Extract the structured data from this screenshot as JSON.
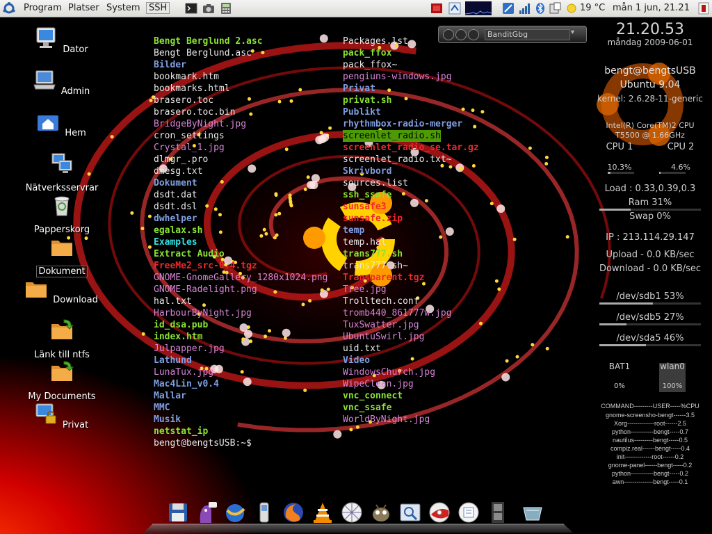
{
  "top_panel": {
    "menus": [
      "Program",
      "Platser",
      "System"
    ],
    "ssh_label": "SSH",
    "temperature": "19 °C",
    "clock": "mån  1 jun, 21.21",
    "icons": [
      "ubuntu-logo-icon",
      "terminal-icon",
      "camera-icon",
      "calculator-icon",
      "notes-icon",
      "update-icon",
      "network-monitor-icon",
      "rss-icon",
      "signal-icon",
      "bluetooth-icon",
      "power-icon",
      "weather-sun-icon",
      "logout-icon"
    ]
  },
  "desktop_icons": [
    {
      "label": "Dator",
      "icon": "computer-icon"
    },
    {
      "label": "Admin",
      "icon": "laptop-icon"
    },
    {
      "label": "Hem",
      "icon": "home-folder-icon"
    },
    {
      "label": "Nätverksservrar",
      "icon": "network-servers-icon"
    },
    {
      "label": "Papperskorg",
      "icon": "trash-icon"
    },
    {
      "label": "Dokument",
      "icon": "folder-icon",
      "selected": true
    },
    {
      "label": "Download",
      "icon": "folder-icon"
    },
    {
      "label": "Länk till ntfs",
      "icon": "folder-link-icon"
    },
    {
      "label": "My Documents",
      "icon": "folder-link-icon"
    },
    {
      "label": "Privat",
      "icon": "locked-computer-icon"
    }
  ],
  "ls_listing": {
    "column1": [
      {
        "name": "Bengt Berglund 2.asc",
        "type": "exe"
      },
      {
        "name": "Bengt Berglund.asc",
        "type": "file"
      },
      {
        "name": "Bilder",
        "type": "dir"
      },
      {
        "name": "bookmark.htm",
        "type": "file"
      },
      {
        "name": "bookmarks.html",
        "type": "file"
      },
      {
        "name": "brasero.toc",
        "type": "file"
      },
      {
        "name": "brasero.toc.bin",
        "type": "file"
      },
      {
        "name": "BridgeByNight.jpg",
        "type": "img"
      },
      {
        "name": "cron_settings",
        "type": "file"
      },
      {
        "name": "Crystal_1.jpg",
        "type": "img"
      },
      {
        "name": "dlmgr_.pro",
        "type": "file"
      },
      {
        "name": "dmesg.txt",
        "type": "file"
      },
      {
        "name": "Dokument",
        "type": "dir"
      },
      {
        "name": "dsdt.dat",
        "type": "file"
      },
      {
        "name": "dsdt.dsl",
        "type": "file"
      },
      {
        "name": "dwhelper",
        "type": "dir"
      },
      {
        "name": "egalax.sh",
        "type": "exe"
      },
      {
        "name": "Examples",
        "type": "link"
      },
      {
        "name": "Extract Audio",
        "type": "exe"
      },
      {
        "name": "FreeMe2_src-0.4.tgz",
        "type": "arc"
      },
      {
        "name": "GNOME-GnomeGallery_1280x1024.png",
        "type": "img"
      },
      {
        "name": "GNOME-Radelight.png",
        "type": "img"
      },
      {
        "name": "hal.txt",
        "type": "file"
      },
      {
        "name": "HarbourByNight.jpg",
        "type": "img"
      },
      {
        "name": "id_dsa.pub",
        "type": "exe"
      },
      {
        "name": "index.htm",
        "type": "exe"
      },
      {
        "name": "Julpapper.jpg",
        "type": "img"
      },
      {
        "name": "Lathund",
        "type": "dir"
      },
      {
        "name": "LunaTux.jpg",
        "type": "img"
      },
      {
        "name": "Mac4Lin_v0.4",
        "type": "dir"
      },
      {
        "name": "Mallar",
        "type": "dir"
      },
      {
        "name": "MMC",
        "type": "dir"
      },
      {
        "name": "Musik",
        "type": "dir"
      },
      {
        "name": "netstat_ip",
        "type": "exe"
      },
      {
        "name": "bengt@bengtsUSB:~$",
        "type": "prompt"
      }
    ],
    "column2": [
      {
        "name": "Packages.lst",
        "type": "file"
      },
      {
        "name": "pack_ffox",
        "type": "exe"
      },
      {
        "name": "pack_ffox~",
        "type": "file"
      },
      {
        "name": "pengiuns-windows.jpg",
        "type": "img"
      },
      {
        "name": "Privat",
        "type": "dir"
      },
      {
        "name": "privat.sh",
        "type": "exe"
      },
      {
        "name": "Publikt",
        "type": "dir"
      },
      {
        "name": "rhythmbox-radio-merger",
        "type": "dir"
      },
      {
        "name": "screenlet_radio.sh",
        "type": "hl"
      },
      {
        "name": "screenlet_radio_se.tar.gz",
        "type": "arc"
      },
      {
        "name": "screenlet_radio.txt~",
        "type": "file"
      },
      {
        "name": "Skrivbord",
        "type": "dir"
      },
      {
        "name": "sources.list",
        "type": "file"
      },
      {
        "name": "ssh_ssafe",
        "type": "exe"
      },
      {
        "name": "sunsafe3",
        "type": "arc"
      },
      {
        "name": "sunsafe.zip",
        "type": "arc"
      },
      {
        "name": "temp",
        "type": "dir"
      },
      {
        "name": "temp.hal",
        "type": "file"
      },
      {
        "name": "trans777.sh",
        "type": "exe"
      },
      {
        "name": "trans777.sh~",
        "type": "file"
      },
      {
        "name": "Transparent.tgz",
        "type": "arc"
      },
      {
        "name": "Tree.jpg",
        "type": "img"
      },
      {
        "name": "Trolltech.conf",
        "type": "file"
      },
      {
        "name": "tromb440_861777w.jpg",
        "type": "img"
      },
      {
        "name": "TuxSwatter.jpg",
        "type": "img"
      },
      {
        "name": "UbuntuSwirl.jpg",
        "type": "img"
      },
      {
        "name": "uid.txt",
        "type": "file"
      },
      {
        "name": "Video",
        "type": "dir"
      },
      {
        "name": "WindowsChurch.jpg",
        "type": "img"
      },
      {
        "name": "WipeClean.jpg",
        "type": "img"
      },
      {
        "name": "vnc_connect",
        "type": "exe"
      },
      {
        "name": "vnc_ssafe",
        "type": "exe"
      },
      {
        "name": "WorldByNight.jpg",
        "type": "img"
      }
    ]
  },
  "player": {
    "station": "BanditGbg"
  },
  "conky": {
    "time": "21.20.53",
    "date": "måndag 2009-06-01",
    "user": "bengt@bengtsUSB",
    "os": "Ubuntu 9.04",
    "kernel": "kernel: 2.6.28-11-generic",
    "cpu_model": "Intel(R) Core(TM)2 CPU",
    "cpu_speed": "T5500  @ 1.66GHz",
    "cpu1_label": "CPU 1",
    "cpu2_label": "CPU 2",
    "cpu1_value": "10.3%",
    "cpu2_value": "4.6%",
    "cpu1_fraction": 0.103,
    "cpu2_fraction": 0.046,
    "load": "Load : 0.33,0.39,0.3",
    "ram": "Ram 31%",
    "ram_fraction": 0.31,
    "swap": "Swap 0%",
    "ip": "IP : 213.114.29.147",
    "upload": "Upload - 0.0 KB/sec",
    "download": "Download - 0.0 KB/sec",
    "disks": [
      {
        "label": "/dev/sdb1 53%",
        "fraction": 0.53
      },
      {
        "label": "/dev/sdb5 27%",
        "fraction": 0.27
      },
      {
        "label": "/dev/sda5 46%",
        "fraction": 0.46
      }
    ],
    "bat_label": "BAT1",
    "bat_value": "0%",
    "wlan_label": "wlan0",
    "wlan_value": "100%",
    "process_header": "COMMAND---------USER-----%CPU",
    "processes": [
      "gnome-screensho-bengt------3.5",
      "Xorg-------------root------2.5",
      "python-----------bengt-----0.7",
      "nautilus---------bengt-----0.5",
      "compiz.real------bengt-----0.4",
      "init-------------root------0.2",
      "gnome-panel------bengt-----0.2",
      "python-----------bengt-----0.2",
      "awn--------------bengt-----0.1"
    ]
  },
  "dock": {
    "items": [
      "floppy-save-icon",
      "pidgin-icon",
      "thunderbird-icon",
      "mobile-phone-icon",
      "firefox-icon",
      "vlc-icon",
      "web-icon",
      "gimp-icon",
      "image-viewer-icon",
      "disk-icon",
      "sticky-notes-icon",
      "film-icon",
      "trash-dock-icon"
    ]
  }
}
